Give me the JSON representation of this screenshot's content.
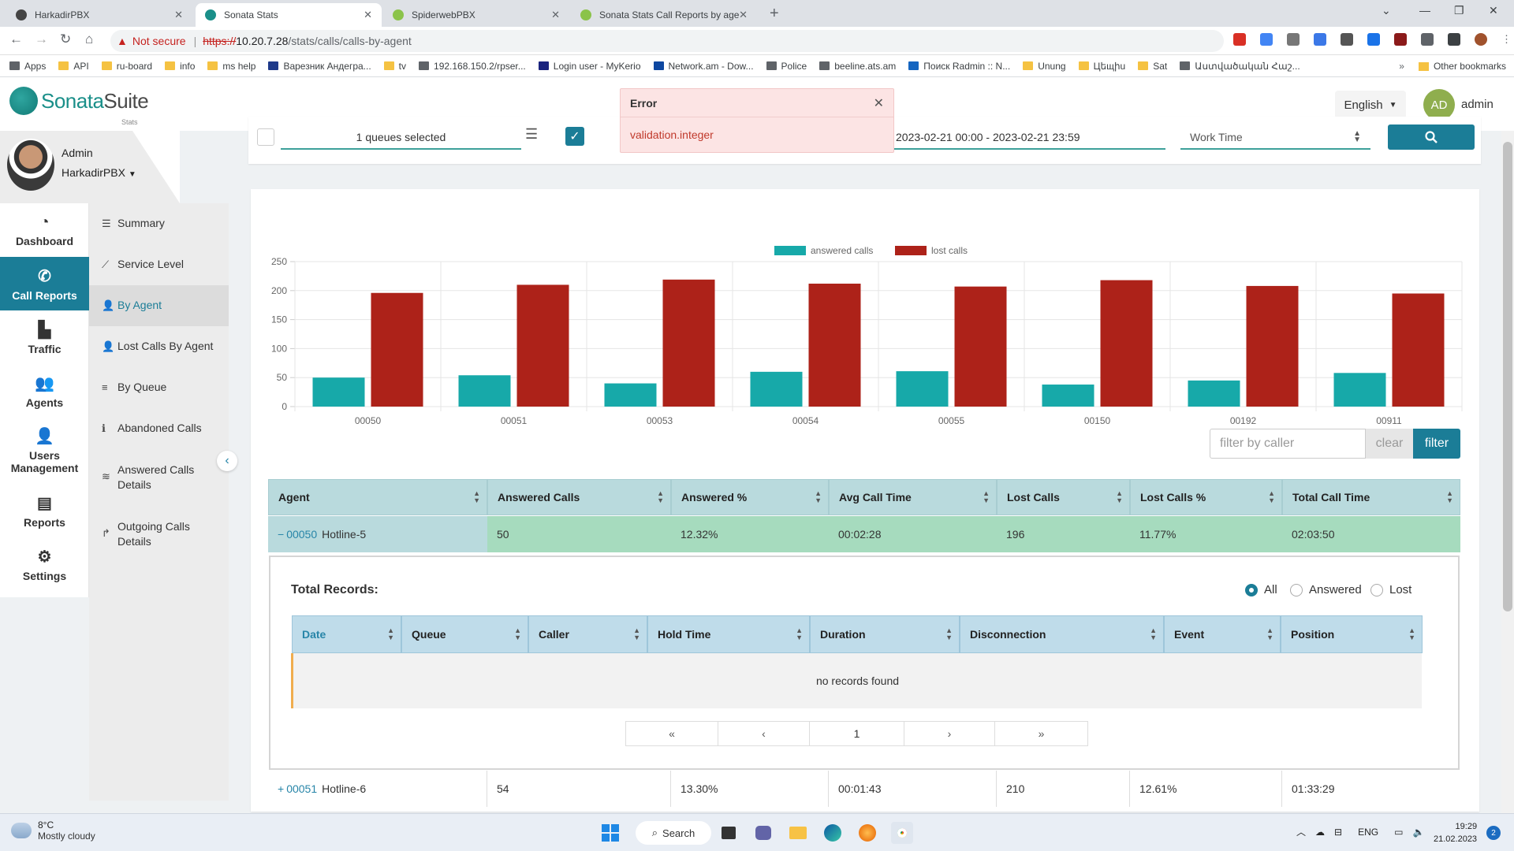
{
  "browser": {
    "tabs": [
      {
        "title": "HarkadirPBX",
        "color": "#444"
      },
      {
        "title": "Sonata Stats",
        "color": "#1a8f89"
      },
      {
        "title": "SpiderwebPBX",
        "color": "#8bc34a"
      },
      {
        "title": "Sonata Stats Call Reports by agen",
        "color": "#8bc34a"
      }
    ],
    "address": {
      "warning": "Not secure",
      "scheme": "https://",
      "host": "10.20.7.28",
      "path": "/stats/calls/calls-by-agent"
    },
    "bookmarks": [
      "Apps",
      "API",
      "ru-board",
      "info",
      "ms help",
      "Варезник Андегра...",
      "tv",
      "192.168.150.2/rpser...",
      "Login user - MyKerio",
      "Network.am - Dow...",
      "Police",
      "beeline.ats.am",
      "Поиск Radmin :: N...",
      "Unung",
      "Цեщիu",
      "Sat",
      "Աստվածական Հաշ..."
    ],
    "other_bookmarks": "Other bookmarks"
  },
  "app": {
    "brand_a": "Sonata",
    "brand_b": "Suite",
    "brand_sub": "Stats",
    "language": "English",
    "avatar_initials": "AD",
    "account": "admin"
  },
  "user": {
    "name": "Admin",
    "org": "HarkadirPBX"
  },
  "nav": [
    {
      "label": "Dashboard",
      "icon": "◔"
    },
    {
      "label": "Call Reports",
      "icon": "✆"
    },
    {
      "label": "Traffic",
      "icon": "▙"
    },
    {
      "label": "Agents",
      "icon": "👥"
    },
    {
      "label": "Users Management",
      "icon": "👤"
    },
    {
      "label": "Reports",
      "icon": "▤"
    },
    {
      "label": "Settings",
      "icon": "⚙"
    }
  ],
  "subnav": [
    {
      "label": "Summary",
      "icon": "☰"
    },
    {
      "label": "Service Level",
      "icon": "⟋"
    },
    {
      "label": "By Agent",
      "icon": "👤"
    },
    {
      "label": "Lost Calls By Agent",
      "icon": "👤"
    },
    {
      "label": "By Queue",
      "icon": "≡"
    },
    {
      "label": "Abandoned Calls",
      "icon": "ℹ"
    },
    {
      "label": "Answered Calls Details",
      "icon": "≋"
    },
    {
      "label": "Outgoing Calls Details",
      "icon": "↱"
    }
  ],
  "filters": {
    "queues": "1 queues selected",
    "daterange": "2023-02-21 00:00 - 2023-02-21 23:59",
    "worktime": "Work Time"
  },
  "toast": {
    "title": "Error",
    "message": "validation.integer"
  },
  "chart_data": {
    "type": "bar",
    "categories": [
      "00050",
      "00051",
      "00053",
      "00054",
      "00055",
      "00150",
      "00192",
      "00911"
    ],
    "series": [
      {
        "name": "answered calls",
        "color": "#17a9a9",
        "values": [
          50,
          54,
          40,
          60,
          61,
          38,
          45,
          58
        ]
      },
      {
        "name": "lost calls",
        "color": "#ad2219",
        "values": [
          196,
          210,
          219,
          212,
          207,
          218,
          208,
          195
        ]
      }
    ],
    "ylim": [
      0,
      250
    ],
    "yticks": [
      0,
      50,
      100,
      150,
      200,
      250
    ],
    "legend": "top-center",
    "grid": true
  },
  "caller_filter": {
    "placeholder": "filter by caller",
    "clear": "clear",
    "filter": "filter"
  },
  "table": {
    "headers": [
      "Agent",
      "Answered Calls",
      "Answered %",
      "Avg Call Time",
      "Lost Calls",
      "Lost Calls %",
      "Total Call Time"
    ],
    "rows": [
      {
        "toggle": "−",
        "id": "00050",
        "name": "Hotline-5",
        "answered": "50",
        "answered_pct": "12.32%",
        "avg": "00:02:28",
        "lost": "196",
        "lost_pct": "11.77%",
        "total": "02:03:50"
      },
      {
        "toggle": "+",
        "id": "00051",
        "name": "Hotline-6",
        "answered": "54",
        "answered_pct": "13.30%",
        "avg": "00:01:43",
        "lost": "210",
        "lost_pct": "12.61%",
        "total": "01:33:29"
      }
    ]
  },
  "details": {
    "title": "Total Records:",
    "radios": [
      "All",
      "Answered",
      "Lost"
    ],
    "headers": [
      "Date",
      "Queue",
      "Caller",
      "Hold Time",
      "Duration",
      "Disconnection",
      "Event",
      "Position"
    ],
    "empty": "no records found",
    "pagination": [
      "«",
      "‹",
      "1",
      "›",
      "»"
    ]
  },
  "taskbar": {
    "temp": "8°C",
    "weather": "Mostly cloudy",
    "search": "Search",
    "lang": "ENG",
    "time": "19:29",
    "date": "21.02.2023",
    "notifications": "2"
  }
}
